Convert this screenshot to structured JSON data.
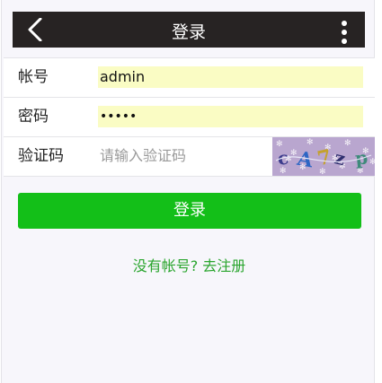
{
  "navbar": {
    "title": "登录",
    "back_icon": "chevron-left-icon",
    "menu_icon": "more-vertical-icon"
  },
  "form": {
    "username": {
      "label": "帐号",
      "value": "admin"
    },
    "password": {
      "label": "密码",
      "value": "•••••"
    },
    "captcha": {
      "label": "验证码",
      "placeholder": "请输入验证码",
      "image_text": "cA7zp"
    }
  },
  "login_button": {
    "label": "登录"
  },
  "register_link": {
    "label": "没有帐号? 去注册"
  },
  "colors": {
    "navbar_bg": "#272323",
    "primary_green": "#13bf18",
    "link_green": "#2aa52e",
    "autofill_yellow": "#fafcc4"
  }
}
